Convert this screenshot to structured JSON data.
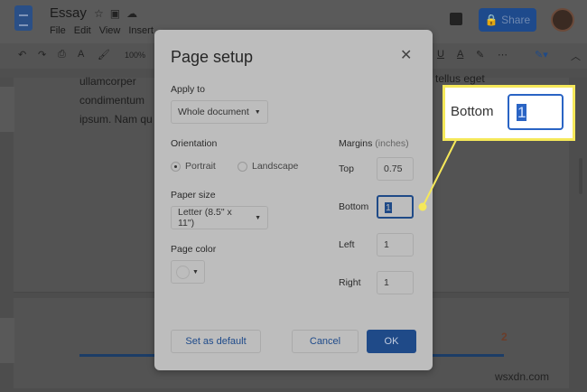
{
  "app": {
    "title": "Essay",
    "menu": [
      "File",
      "Edit",
      "View",
      "Insert"
    ],
    "share_label": "Share",
    "zoom": "100%"
  },
  "document": {
    "lines": [
      "ullamcorper",
      "condimentum",
      "ipsum. Nam qu"
    ],
    "right_fragment": "tellus eget",
    "page_number": "2"
  },
  "dialog": {
    "title": "Page setup",
    "apply_to_label": "Apply to",
    "apply_to_value": "Whole document",
    "orientation_label": "Orientation",
    "portrait": "Portrait",
    "landscape": "Landscape",
    "orientation_selected": "Portrait",
    "paper_size_label": "Paper size",
    "paper_size_value": "Letter (8.5\" x 11\")",
    "page_color_label": "Page color",
    "margins_label": "Margins",
    "margins_unit": "(inches)",
    "margins": {
      "top_label": "Top",
      "top": "0.75",
      "bottom_label": "Bottom",
      "bottom": "1",
      "left_label": "Left",
      "left": "1",
      "right_label": "Right",
      "right": "1"
    },
    "set_default": "Set as default",
    "cancel": "Cancel",
    "ok": "OK"
  },
  "callout": {
    "label": "Bottom",
    "value": "1"
  },
  "watermark": "wsxdn.com",
  "colors": {
    "accent": "#1f4a88",
    "callout_border": "#f5e85a"
  }
}
